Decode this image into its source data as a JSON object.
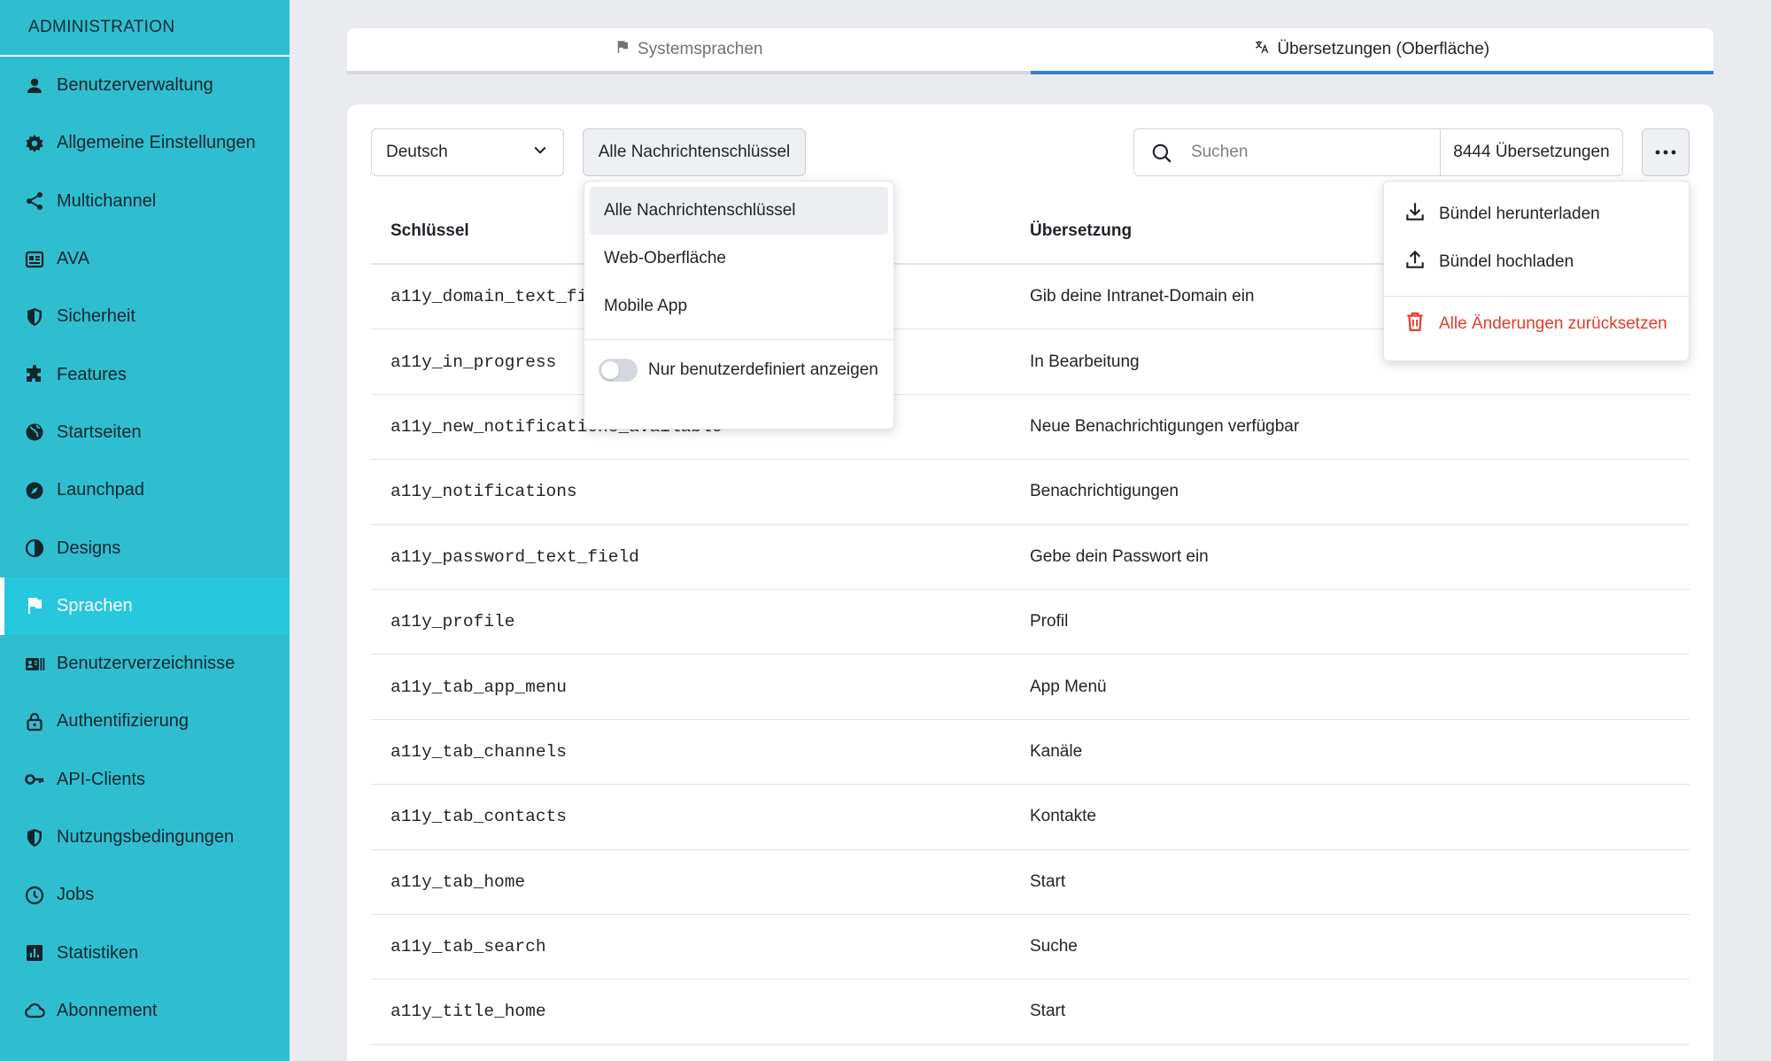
{
  "sidebar": {
    "header": "ADMINISTRATION",
    "items": [
      {
        "label": "Benutzerverwaltung",
        "icon": "person-icon"
      },
      {
        "label": "Allgemeine Einstellungen",
        "icon": "gear-icon"
      },
      {
        "label": "Multichannel",
        "icon": "share-icon"
      },
      {
        "label": "AVA",
        "icon": "ava-icon"
      },
      {
        "label": "Sicherheit",
        "icon": "shield-icon"
      },
      {
        "label": "Features",
        "icon": "puzzle-icon"
      },
      {
        "label": "Startseiten",
        "icon": "globe-icon"
      },
      {
        "label": "Launchpad",
        "icon": "compass-icon"
      },
      {
        "label": "Designs",
        "icon": "contrast-icon"
      },
      {
        "label": "Sprachen",
        "icon": "flag-icon",
        "active": true
      },
      {
        "label": "Benutzerverzeichnisse",
        "icon": "directory-icon"
      },
      {
        "label": "Authentifizierung",
        "icon": "lock-icon"
      },
      {
        "label": "API-Clients",
        "icon": "key-icon"
      },
      {
        "label": "Nutzungsbedingungen",
        "icon": "shield-icon"
      },
      {
        "label": "Jobs",
        "icon": "clock-icon"
      },
      {
        "label": "Statistiken",
        "icon": "chart-icon"
      },
      {
        "label": "Abonnement",
        "icon": "cloud-icon"
      }
    ]
  },
  "tabs": {
    "system_languages": "Systemsprachen",
    "translations": "Übersetzungen (Oberfläche)"
  },
  "toolbar": {
    "language": "Deutsch",
    "filter": "Alle Nachrichtenschlüssel",
    "search_placeholder": "Suchen",
    "count": "8444 Übersetzungen",
    "more": "···"
  },
  "table": {
    "headers": {
      "key": "Schlüssel",
      "value": "Übersetzung"
    },
    "rows": [
      {
        "key": "a11y_domain_text_field",
        "value": "Gib deine Intranet-Domain ein"
      },
      {
        "key": "a11y_in_progress",
        "value": "In Bearbeitung"
      },
      {
        "key": "a11y_new_notifications_available",
        "value": "Neue Benachrichtigungen verfügbar"
      },
      {
        "key": "a11y_notifications",
        "value": "Benachrichtigungen"
      },
      {
        "key": "a11y_password_text_field",
        "value": "Gebe dein Passwort ein"
      },
      {
        "key": "a11y_profile",
        "value": "Profil"
      },
      {
        "key": "a11y_tab_app_menu",
        "value": "App Menü"
      },
      {
        "key": "a11y_tab_channels",
        "value": "Kanäle"
      },
      {
        "key": "a11y_tab_contacts",
        "value": "Kontakte"
      },
      {
        "key": "a11y_tab_home",
        "value": "Start"
      },
      {
        "key": "a11y_tab_search",
        "value": "Suche"
      },
      {
        "key": "a11y_title_home",
        "value": "Start"
      }
    ]
  },
  "filter_dropdown": {
    "options": [
      "Alle Nachrichtenschlüssel",
      "Web-Oberfläche",
      "Mobile App"
    ],
    "toggle_label": "Nur benutzerdefiniert anzeigen",
    "toggle_on": false
  },
  "more_menu": {
    "download": "Bündel herunterladen",
    "upload": "Bündel hochladen",
    "reset": "Alle Änderungen zurücksetzen"
  },
  "colors": {
    "sidebar": "#2fbed0",
    "sidebar_active": "#27c8dd",
    "tab_active_underline": "#2f7fd6",
    "danger": "#e13b2c"
  }
}
